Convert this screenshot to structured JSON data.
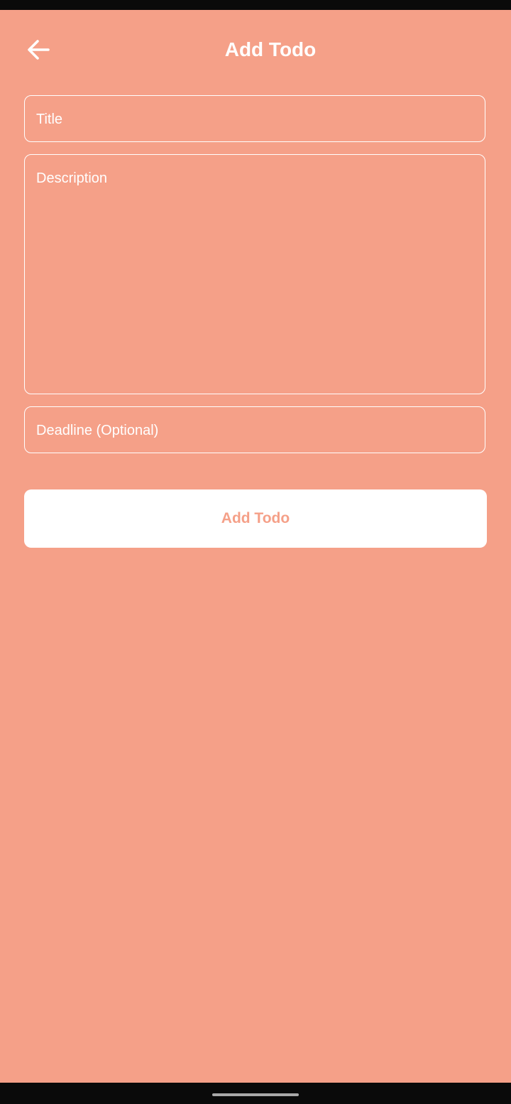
{
  "app_bar": {
    "title": "Add Todo",
    "back_icon": "arrow-left-icon"
  },
  "form": {
    "title_placeholder": "Title",
    "description_placeholder": "Description",
    "deadline_placeholder": "Deadline (Optional)",
    "submit_label": "Add Todo"
  },
  "colors": {
    "background": "#f5a088",
    "accent_text": "#f5a088",
    "field_border": "#ffffff",
    "button_background": "#ffffff",
    "system_bars": "#0a0a0a"
  }
}
